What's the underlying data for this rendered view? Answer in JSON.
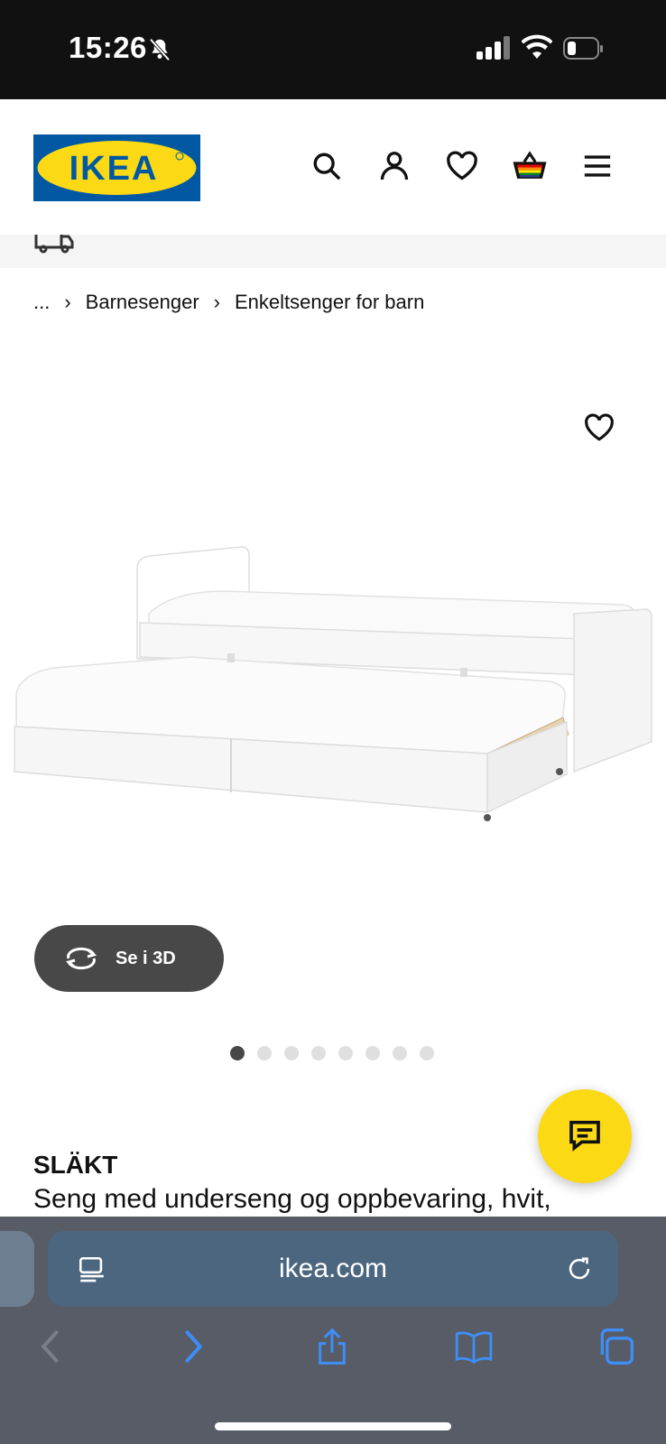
{
  "status_bar": {
    "time": "15:26"
  },
  "header": {
    "logo_text": "IKEA",
    "icons": [
      "search-icon",
      "account-icon",
      "heart-icon",
      "basket-icon",
      "menu-icon"
    ]
  },
  "breadcrumb": {
    "ellipsis": "...",
    "items": [
      "Barnesenger",
      "Enkeltsenger for barn"
    ]
  },
  "gallery": {
    "view_3d_label": "Se i 3D",
    "dot_count": 8,
    "active_dot": 0
  },
  "product": {
    "name": "SLÄKT",
    "description": "Seng med underseng og oppbevaring, hvit,"
  },
  "browser": {
    "url": "ikea.com"
  },
  "colors": {
    "ikea_blue": "#0058a3",
    "ikea_yellow": "#fbd914",
    "button_dark": "#484848",
    "safari_url_bar": "#4d6680",
    "safari_icon_blue": "#3e8ef7"
  }
}
